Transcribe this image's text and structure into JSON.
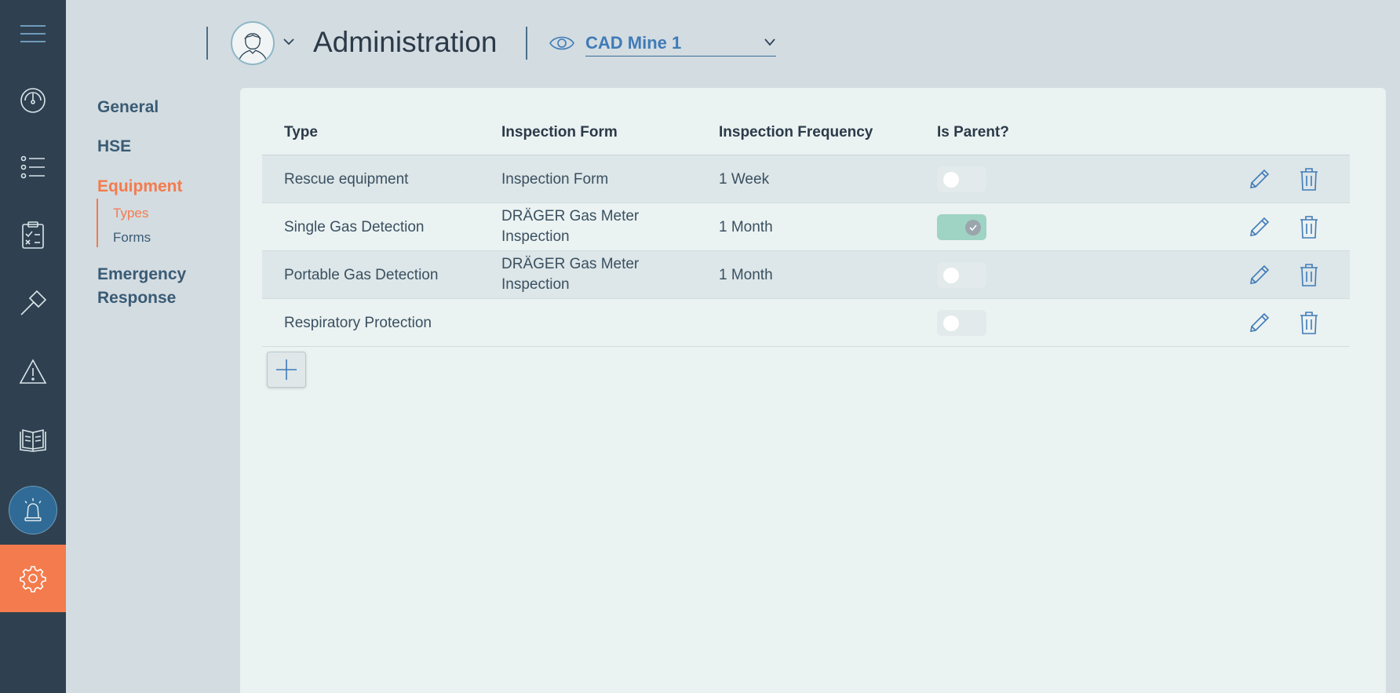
{
  "header": {
    "title": "Administration",
    "site_selector": {
      "value": "CAD Mine 1"
    }
  },
  "rail": {
    "icons": [
      "menu-icon",
      "dashboard-icon",
      "list-icon",
      "checklist-icon",
      "hammer-icon",
      "warning-icon",
      "book-icon",
      "alarm-icon",
      "gear-icon"
    ],
    "active": "alarm-icon",
    "accent_color": "#f47b4d"
  },
  "subnav": {
    "general": "General",
    "hse": "HSE",
    "equipment": "Equipment",
    "equipment_children": {
      "types": "Types",
      "forms": "Forms"
    },
    "emergency_response_line1": "Emergency",
    "emergency_response_line2": "Response"
  },
  "table": {
    "columns": {
      "type": "Type",
      "inspection_form": "Inspection Form",
      "inspection_frequency": "Inspection Frequency",
      "is_parent": "Is Parent?"
    },
    "rows": [
      {
        "type": "Rescue equipment",
        "inspection_form": "Inspection Form",
        "inspection_frequency": "1 Week",
        "is_parent": false
      },
      {
        "type": "Single Gas Detection",
        "inspection_form": "DRÄGER Gas Meter Inspection",
        "inspection_frequency": "1 Month",
        "is_parent": true
      },
      {
        "type": "Portable Gas Detection",
        "inspection_form": "DRÄGER Gas Meter Inspection",
        "inspection_frequency": "1 Month",
        "is_parent": false
      },
      {
        "type": "Respiratory Protection",
        "inspection_form": "",
        "inspection_frequency": "",
        "is_parent": false
      }
    ]
  }
}
